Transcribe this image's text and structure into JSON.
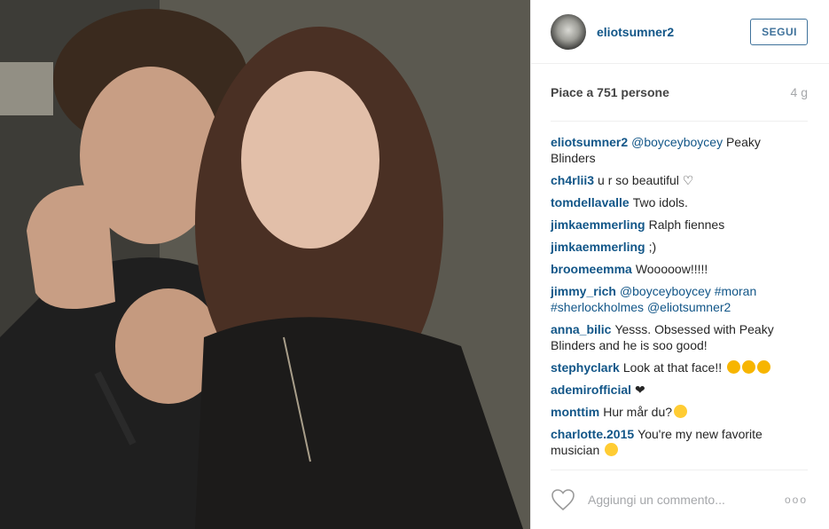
{
  "post": {
    "username": "eliotsumner2",
    "follow_label": "SEGUI",
    "likes": "Piace a 751 persone",
    "time": "4 g"
  },
  "comments": [
    {
      "author": "eliotsumner2",
      "parts": [
        {
          "mention": "@boyceyboycey"
        },
        {
          "text": " Peaky Blinders"
        }
      ]
    },
    {
      "author": "ch4rlii3",
      "parts": [
        {
          "text": "u r so beautiful ♡"
        }
      ]
    },
    {
      "author": "tomdellavalle",
      "parts": [
        {
          "text": "Two idols."
        }
      ]
    },
    {
      "author": "jimkaemmerling",
      "parts": [
        {
          "text": "Ralph fiennes"
        }
      ]
    },
    {
      "author": "jimkaemmerling",
      "parts": [
        {
          "text": ";)"
        }
      ]
    },
    {
      "author": "broomeemma",
      "parts": [
        {
          "text": "Wooooow!!!!!"
        }
      ]
    },
    {
      "author": "jimmy_rich",
      "parts": [
        {
          "mention": "@boyceyboycey"
        },
        {
          "text": " "
        },
        {
          "mention": "#moran"
        },
        {
          "text": " "
        },
        {
          "mention": "#sherlockholmes"
        },
        {
          "text": " "
        },
        {
          "mention": "@eliotsumner2"
        }
      ]
    },
    {
      "author": "anna_bilic",
      "parts": [
        {
          "text": "Yesss. Obsessed with Peaky Blinders and he is soo good!"
        }
      ]
    },
    {
      "author": "stephyclark",
      "parts": [
        {
          "text": "Look at that face!! "
        },
        {
          "emoji": "heart-eyes-emoji"
        },
        {
          "emoji": "heart-eyes-emoji"
        },
        {
          "emoji": "heart-eyes-emoji"
        }
      ]
    },
    {
      "author": "ademirofficial",
      "parts": [
        {
          "text": "❤"
        }
      ]
    },
    {
      "author": "monttim",
      "parts": [
        {
          "text": "Hur mår du?"
        },
        {
          "emoji": "kiss-emoji"
        }
      ]
    },
    {
      "author": "charlotte.2015",
      "parts": [
        {
          "text": "You're my new favorite musician "
        },
        {
          "emoji": "kiss-emoji"
        }
      ]
    }
  ],
  "footer": {
    "placeholder": "Aggiungi un commento...",
    "more": "ooo",
    "like_icon": "heart-outline-icon",
    "more_icon": "more-options-icon"
  },
  "colors": {
    "link": "#125688",
    "button": "#3f729b",
    "muted": "#a5a7aa"
  }
}
